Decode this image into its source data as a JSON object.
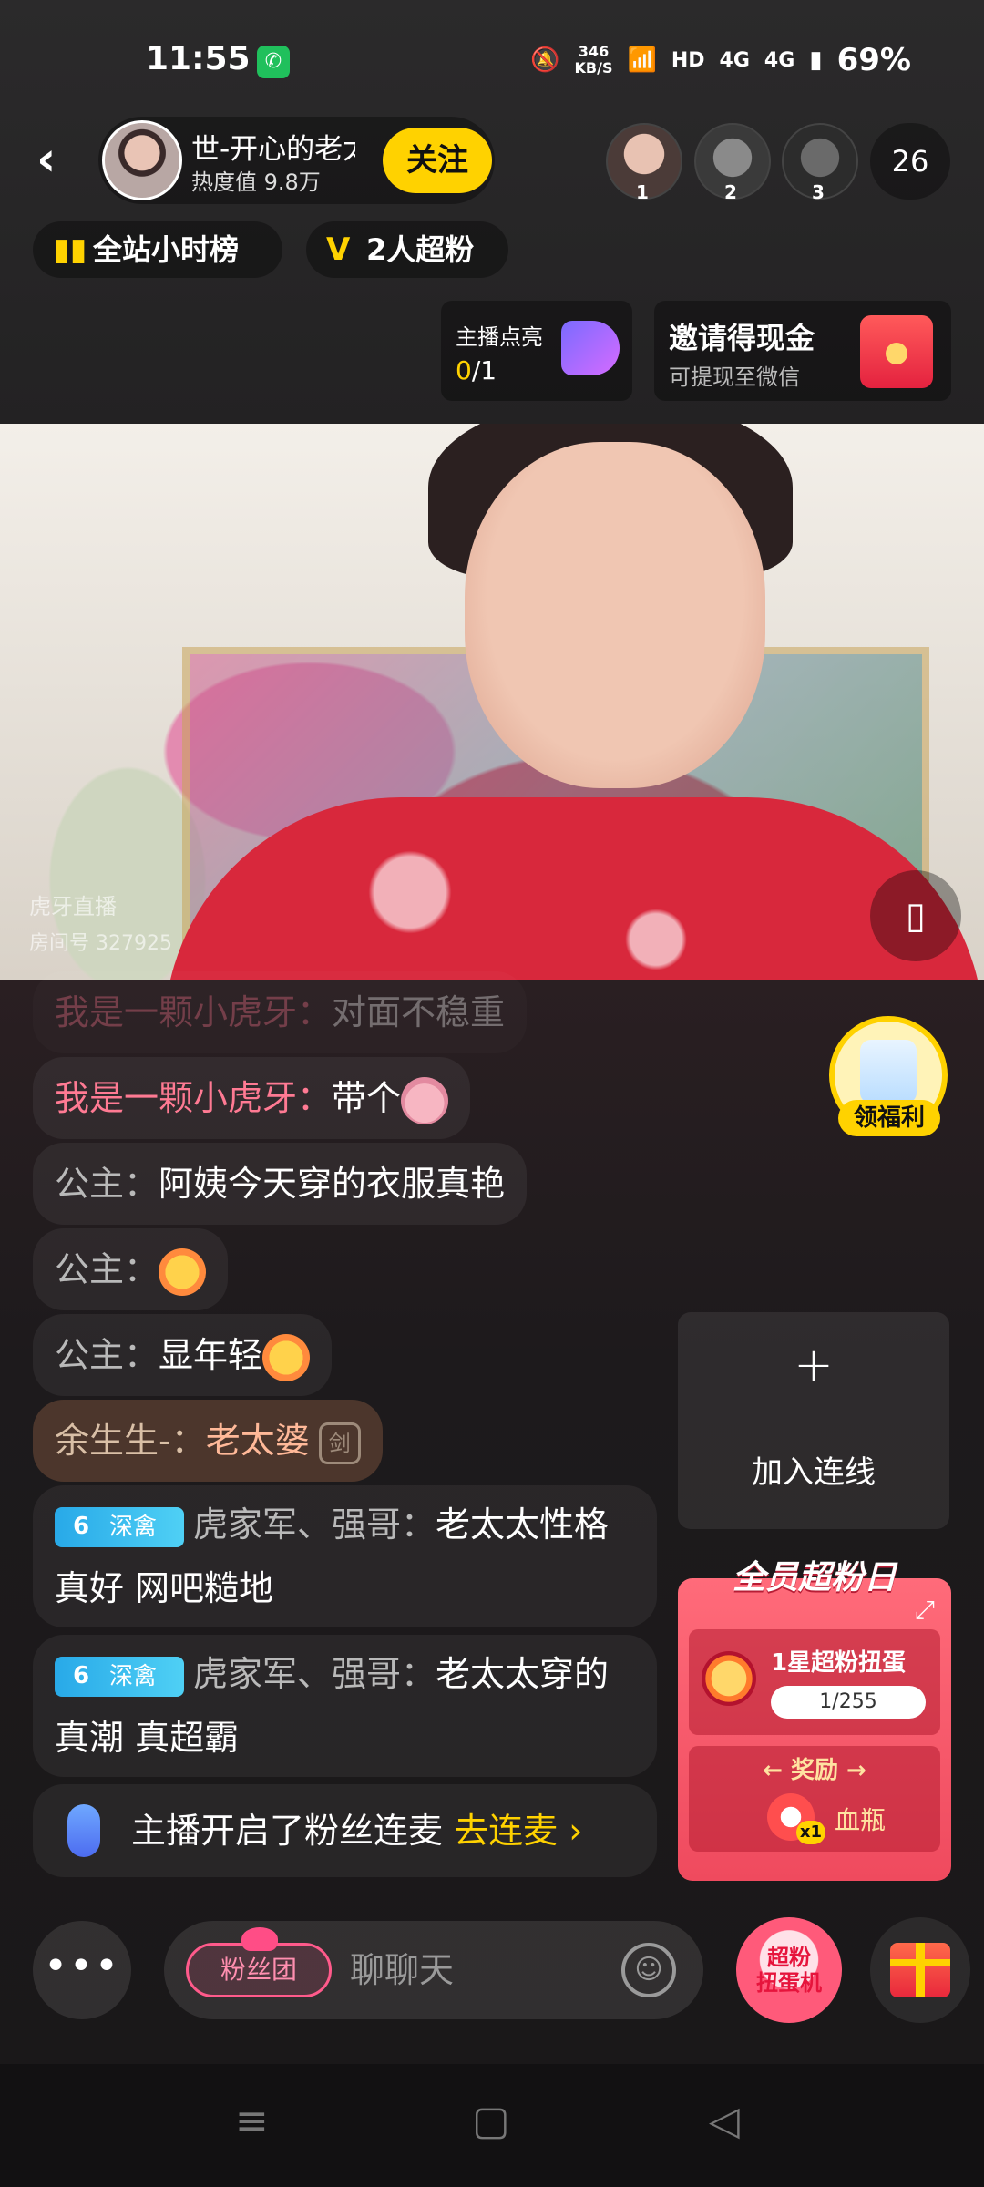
{
  "status_bar": {
    "time": "11:55",
    "net_speed": "346",
    "net_unit": "KB/S",
    "hd": "HD",
    "sig1": "4G",
    "sig2": "4G",
    "battery": "69%"
  },
  "header": {
    "host_name": "世-开心的老太",
    "host_heat": "热度值 9.8万",
    "follow_label": "关注",
    "viewers": [
      {
        "rank": "1"
      },
      {
        "rank": "2"
      },
      {
        "rank": "3"
      }
    ],
    "viewer_count": "26"
  },
  "chips": {
    "hourly_rank": "全站小时榜",
    "superfans": "2人超粉"
  },
  "cards": {
    "light_title": "主播点亮",
    "light_progress_done": "0",
    "light_progress_total": "/1",
    "invite_title": "邀请得现金",
    "invite_sub": "可提现至微信"
  },
  "video": {
    "watermark_name": "虎牙直播",
    "watermark_room": "房间号 327925"
  },
  "chat": {
    "faded": {
      "user": "我是一颗小虎牙：",
      "text": "对面不稳重"
    },
    "messages": [
      {
        "user": "我是一颗小虎牙：",
        "text": "带个"
      },
      {
        "user": "公主：",
        "text": "阿姨今天穿的衣服真艳"
      },
      {
        "user": "公主：",
        "text": ""
      },
      {
        "user": "公主：",
        "text": "显年轻"
      },
      {
        "user": "余生生-：",
        "text": "老太婆",
        "badge": "剑"
      },
      {
        "level": "6",
        "level_name": "深禽",
        "user": "虎家军、强哥：",
        "text": "老太太性格真好 网吧糙地"
      },
      {
        "level": "6",
        "level_name": "深禽",
        "user": "虎家军、强哥：",
        "text": "老太太穿的真潮 真超霸"
      }
    ],
    "mic_notice": "主播开启了粉丝连麦",
    "mic_link": "去连麦"
  },
  "side": {
    "welfare_label": "领福利",
    "join_plus": "+",
    "join_label": "加入连线",
    "superfan_title": "全员超粉日",
    "gacha_name": "1星超粉扭蛋",
    "gacha_progress": "1/255",
    "reward_label": "奖励",
    "reward_count": "x1",
    "reward_item": "血瓶"
  },
  "bottom": {
    "more": "•••",
    "fan_group": "粉丝团",
    "chat_placeholder": "聊聊天",
    "gacha_button_line1": "超粉",
    "gacha_button_line2": "扭蛋机"
  },
  "colors": {
    "accent": "#ffd200",
    "username_pink": "#ff7a93",
    "superfan_red": "#ef4a5e"
  }
}
